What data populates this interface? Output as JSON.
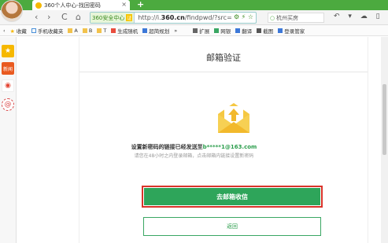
{
  "browser": {
    "tab_title": "360个人中心-找回密码",
    "tab_close": "×",
    "new_tab": "+",
    "nav": {
      "back": "‹",
      "forward": "›",
      "reload": "C",
      "home": "⌂"
    },
    "security_label": "360安全中心",
    "security_badge": "证",
    "url_prefix": "http://i.",
    "url_domain": "360.cn",
    "url_rest": "/findpwd/?src=",
    "search_text": "杭州买房",
    "toolbar_icons": "↶ ▾ ☁ ▯ ≡"
  },
  "bookmarks": [
    {
      "label": "收藏",
      "icon": "star-icon"
    },
    {
      "label": "手机收藏夹",
      "icon": "phone-icon"
    },
    {
      "label": "A",
      "icon": "folder-icon"
    },
    {
      "label": "B",
      "icon": "folder-icon"
    },
    {
      "label": "T",
      "icon": "folder-icon"
    },
    {
      "label": "生成随机",
      "icon": "random-icon"
    },
    {
      "label": "超简规划",
      "icon": "plan-icon"
    },
    {
      "label": "»",
      "icon": ""
    },
    {
      "label": "扩展",
      "icon": "grid-icon"
    },
    {
      "label": "网银",
      "icon": "shield-icon"
    },
    {
      "label": "翻译",
      "icon": "translate-icon"
    },
    {
      "label": "截图",
      "icon": "scissors-icon"
    },
    {
      "label": "登录管家",
      "icon": "key-icon"
    }
  ],
  "sidebar": [
    {
      "icon": "star-icon",
      "glyph": "★",
      "color": "#f6b800"
    },
    {
      "icon": "news-icon",
      "glyph": "新闻",
      "color": "#e95a20"
    },
    {
      "icon": "weibo-icon",
      "glyph": "◉",
      "color": "#e34433"
    },
    {
      "icon": "mail-icon",
      "glyph": "@",
      "color": "#d94b4b"
    }
  ],
  "main": {
    "title": "邮箱验证",
    "message_prefix": "设置新密码的链接已经发送至",
    "message_email": "b*****1@163.com",
    "message_hint": "请您在48小时之内登录邮箱，点击邮箱内链接设置新密码",
    "primary_button": "去邮箱收信",
    "secondary_button": "返回"
  },
  "colors": {
    "accent_green": "#2ea55a",
    "highlight_red": "#d9332a",
    "envelope_yellow": "#f5c842"
  }
}
